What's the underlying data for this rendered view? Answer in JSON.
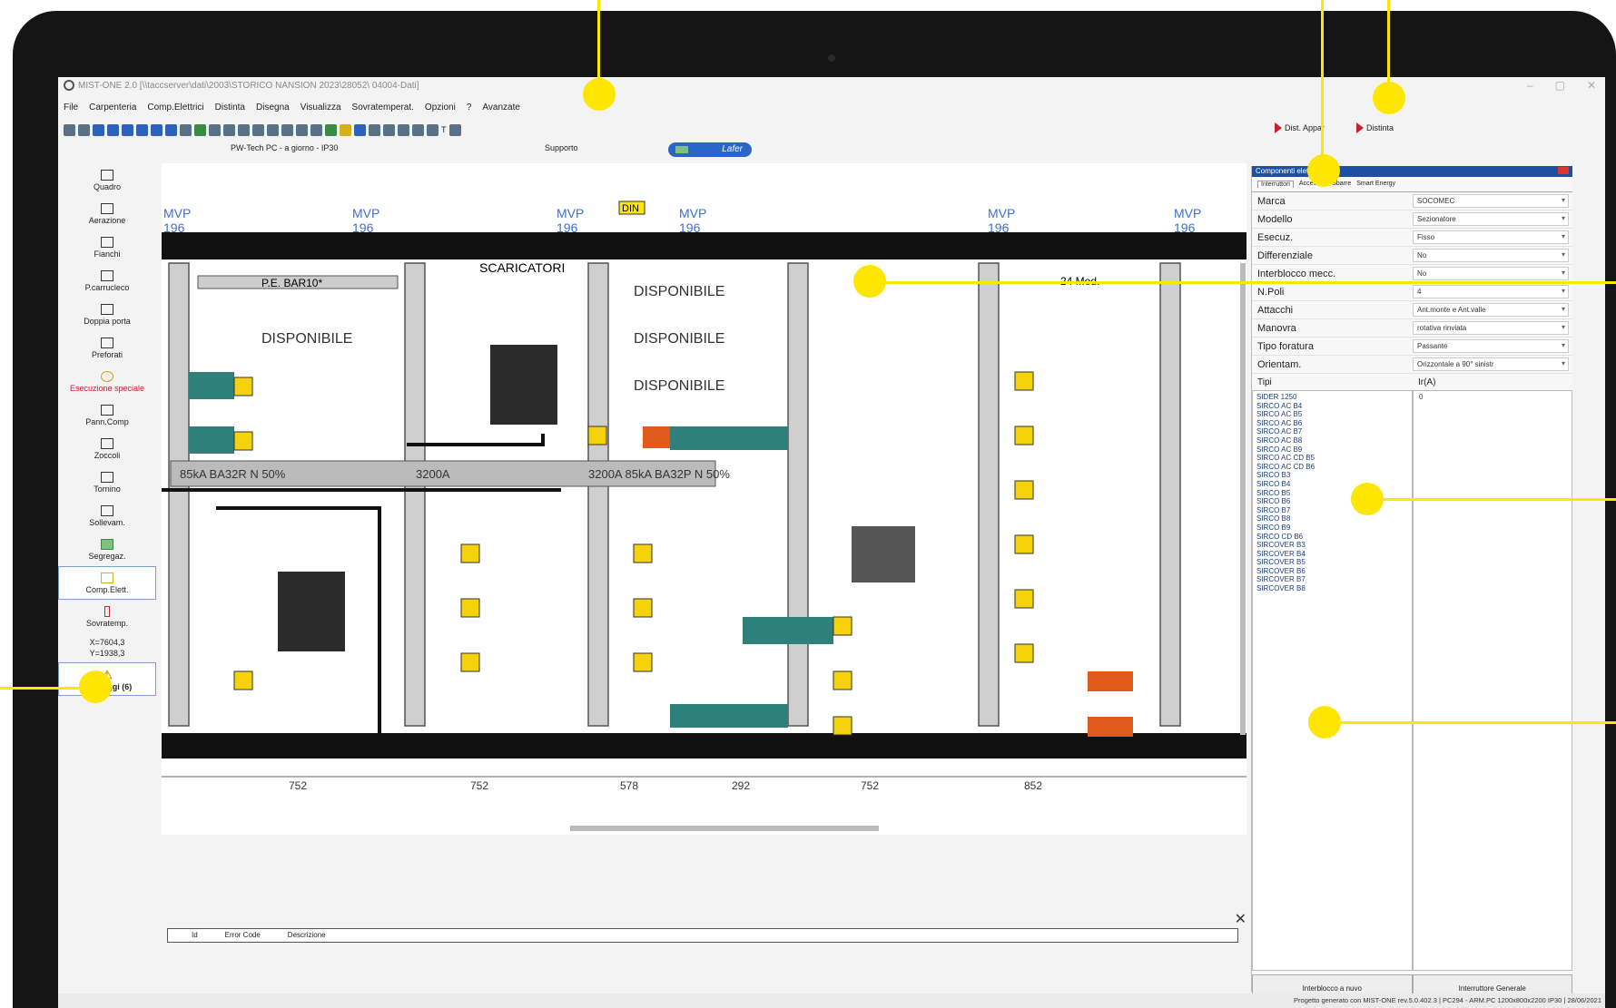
{
  "window": {
    "title": "MIST-ONE 2.0 [\\\\taccserver\\dati\\2003\\STORICO NANSION 2023\\28052\\ 04004-Dati]"
  },
  "menu": [
    "File",
    "Carpenteria",
    "Comp.Elettrici",
    "Distinta",
    "Disegna",
    "Visualizza",
    "Sovratemperat.",
    "Opzioni",
    "?",
    "Avanzate"
  ],
  "toolbar": {
    "supporto": "Supporto",
    "lafer": "Lafer",
    "profile": "PW-Tech PC - a giorno - IP30",
    "dist_appar": "Dist. Appar",
    "distinta": "Distinta"
  },
  "palette": [
    "Quadro",
    "Aerazione",
    "Fianchi",
    "P.carrucleco",
    "Doppia porta",
    "Preforati",
    "Esecuzione speciale",
    "Pann.Comp",
    "Zoccoli",
    "Tornino",
    "Sollevam.",
    "Segregaz.",
    "Comp.Elett.",
    "Sovratemp."
  ],
  "coords": {
    "x": "X=7604,3",
    "y": "Y=1938,3"
  },
  "messages": "Messaggi (6)",
  "drawing": {
    "top_labels": [
      "MVP",
      "196",
      "MVP",
      "196",
      "MVP",
      "196",
      "MVP",
      "196",
      "MVP",
      "196",
      "MVP",
      "196"
    ],
    "din": "DIN",
    "disponibile": "DISPONIBILE",
    "scaricatori": "SCARICATORI",
    "pe_bar": "P.E. BAR10*",
    "mod": "24 Mod.",
    "busbar_1": "85kA BA32R N 50%",
    "busbar_2": "3200A",
    "busbar_3": "3200A 85kA BA32P N 50%",
    "dims": [
      "752",
      "752",
      "578",
      "292",
      "752",
      "852"
    ]
  },
  "errors": {
    "headers": [
      "Id",
      "Error Code",
      "Descrizione"
    ]
  },
  "panel": {
    "title": "Componenti elettrici",
    "tabs": [
      "Interruttori",
      "Accessori",
      "Sbarre",
      "Smart Energy"
    ],
    "props": [
      {
        "label": "Marca",
        "value": "SOCOMEC"
      },
      {
        "label": "Modello",
        "value": "Sezionatore"
      },
      {
        "label": "Esecuz.",
        "value": "Fisso"
      },
      {
        "label": "Differenziale",
        "value": "No"
      },
      {
        "label": "Interblocco mecc.",
        "value": "No"
      },
      {
        "label": "N.Poli",
        "value": "4"
      },
      {
        "label": "Attacchi",
        "value": "Ant.monte e Ant.valle"
      },
      {
        "label": "Manovra",
        "value": "rotativa rinviata"
      },
      {
        "label": "Tipo foratura",
        "value": "Passante"
      },
      {
        "label": "Orientam.",
        "value": "Orizzontale a 90° sinistr"
      }
    ],
    "tipi_header": "Tipi",
    "ir_header": "Ir(A)",
    "tipi": [
      "SIDER 1250",
      "SIRCO AC B4",
      "SIRCO AC B5",
      "SIRCO AC B6",
      "SIRCO AC B7",
      "SIRCO AC B8",
      "SIRCO AC B9",
      "SIRCO AC CD B5",
      "SIRCO AC CD B6",
      "SIRCO B3",
      "SIRCO B4",
      "SIRCO B5",
      "SIRCO B6",
      "SIRCO B7",
      "SIRCO B8",
      "SIRCO B9",
      "SIRCO CD B6",
      "SIRCOVER B3",
      "SIRCOVER B4",
      "SIRCOVER B5",
      "SIRCOVER B6",
      "SIRCOVER B7",
      "SIRCOVER B8"
    ],
    "ir_value": "0",
    "btn_interblocco": "Interblocco a nuvo",
    "btn_generale": "Interruttore Generale"
  },
  "status": "Progetto generato con MIST-ONE rev.5.0.402.3 | PC294 - ARM.PC 1200x800x2200 IP30 | 28/06/2021",
  "colors": {
    "accent": "#ffe600",
    "panel_header": "#1f4fa3",
    "busbar": "#2f7f7b"
  }
}
